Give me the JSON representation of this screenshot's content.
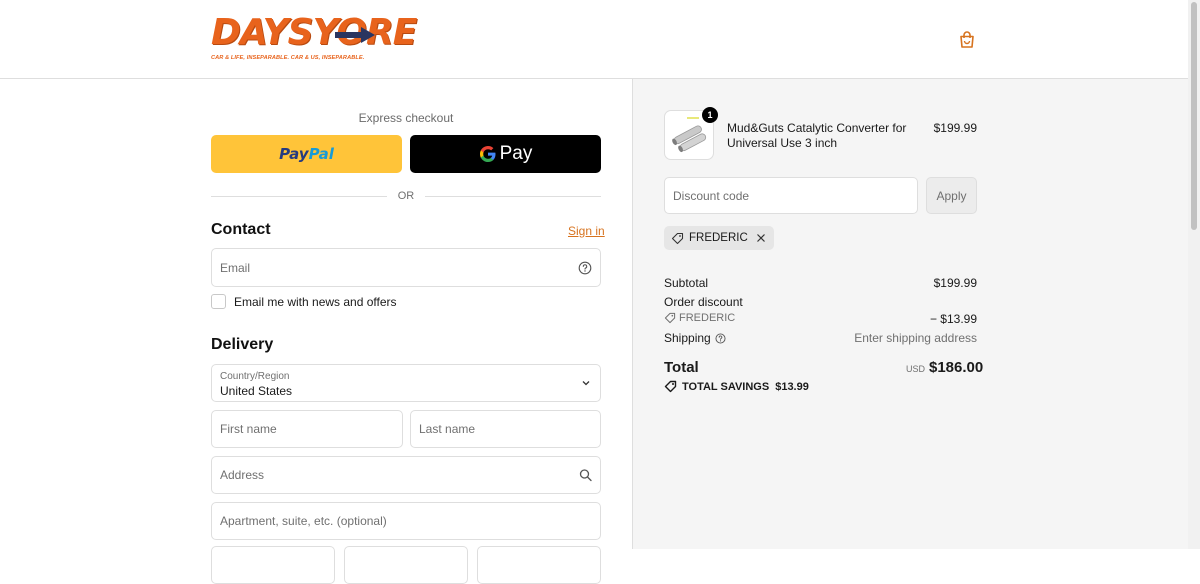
{
  "brand": {
    "name": "DAYSYORE",
    "tagline": "CAR & LIFE, INSEPARABLE. CAR & US, INSEPARABLE.",
    "color": "#e8631c"
  },
  "header": {
    "cart_icon": "shopping-bag-icon"
  },
  "express": {
    "label": "Express checkout",
    "paypal_pay": "Pay",
    "paypal_pal": "Pal",
    "gpay_label": "Pay",
    "or_text": "OR"
  },
  "contact": {
    "title": "Contact",
    "sign_in": "Sign in",
    "email_placeholder": "Email",
    "newsletter_label": "Email me with news and offers"
  },
  "delivery": {
    "title": "Delivery",
    "country_label": "Country/Region",
    "country_value": "United States",
    "first_name_placeholder": "First name",
    "last_name_placeholder": "Last name",
    "address_placeholder": "Address",
    "apartment_placeholder": "Apartment, suite, etc. (optional)"
  },
  "order": {
    "product_name": "Mud&Guts Catalytic Converter for Universal Use 3 inch",
    "product_price": "$199.99",
    "quantity": "1",
    "discount_placeholder": "Discount code",
    "apply_label": "Apply",
    "applied_code": "FREDERIC",
    "subtotal_label": "Subtotal",
    "subtotal_value": "$199.99",
    "order_discount_label": "Order discount",
    "discount_code_line": "FREDERIC",
    "discount_value": "− $13.99",
    "shipping_label": "Shipping",
    "shipping_value": "Enter shipping address",
    "total_label": "Total",
    "currency": "USD",
    "total_value": "$186.00",
    "savings_label": "TOTAL SAVINGS",
    "savings_value": "$13.99"
  },
  "colors": {
    "accent": "#d7731f",
    "paypal_yellow": "#ffc439",
    "summary_bg": "#f5f5f5"
  }
}
